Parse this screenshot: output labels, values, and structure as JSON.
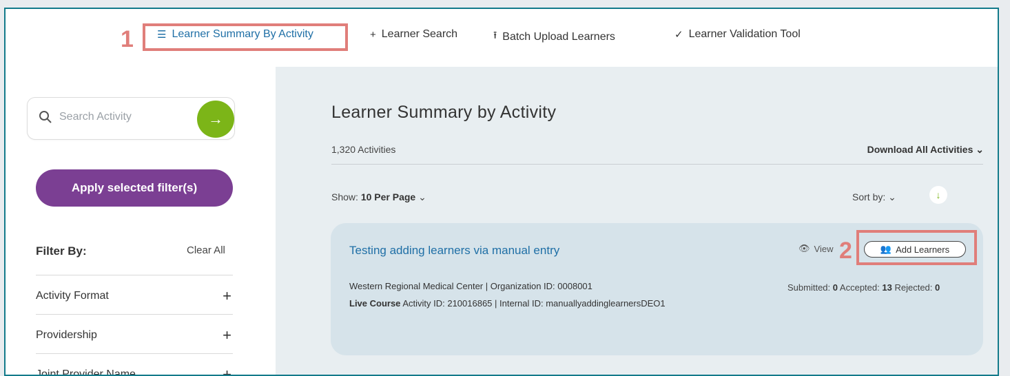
{
  "nav": {
    "items": [
      {
        "icon": "list-icon",
        "label": "Learner Summary By Activity",
        "active": true
      },
      {
        "icon": "plus-icon",
        "label": "Learner Search"
      },
      {
        "icon": "upload-icon",
        "label": "Batch Upload Learners"
      },
      {
        "icon": "check-icon",
        "label": "Learner Validation Tool"
      }
    ]
  },
  "callouts": {
    "one": "1",
    "two": "2"
  },
  "sidebar": {
    "search_placeholder": "Search Activity",
    "apply_label": "Apply selected filter(s)",
    "filter_by": "Filter By:",
    "clear_all": "Clear All",
    "filters": [
      "Activity Format",
      "Providership",
      "Joint Provider Name"
    ]
  },
  "main": {
    "title": "Learner Summary by Activity",
    "count": "1,320 Activities",
    "download": "Download All Activities",
    "show_label": "Show:",
    "show_value": "10 Per Page",
    "sort_label": "Sort by:"
  },
  "card": {
    "title": "Testing adding learners via manual entry",
    "view": "View",
    "add_learners": "Add Learners",
    "org": "Western Regional Medical Center | Organization ID: 0008001",
    "course_type": "Live Course",
    "course_info": "Activity ID: 210016865 | Internal ID: manuallyaddinglearnersDEO1",
    "submitted_label": "Submitted:",
    "submitted": "0",
    "accepted_label": "Accepted:",
    "accepted": "13",
    "rejected_label": "Rejected:",
    "rejected": "0"
  },
  "colors": {
    "accent_green": "#7cb518",
    "accent_purple": "#7b3f93",
    "link_blue": "#1f6fa6",
    "callout": "#e07e7a",
    "frame": "#127a8a"
  }
}
